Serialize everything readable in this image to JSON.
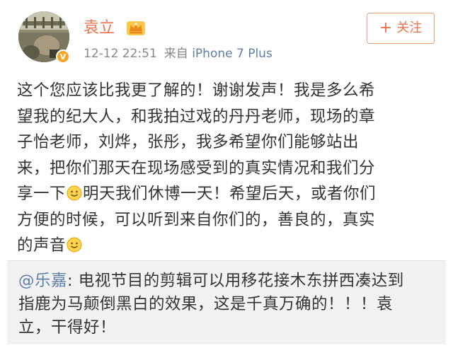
{
  "user": {
    "name": "袁立",
    "verified_badge": "V",
    "time": "12-12 22:51",
    "source_prefix": "来自",
    "device": "iPhone 7 Plus"
  },
  "follow": {
    "plus": "+",
    "label": "关注"
  },
  "post": {
    "lines": [
      "这个您应该比我更了解的！谢谢发声！我是多么希",
      "望我的纪大人，和我拍过戏的丹丹老师，现场的章",
      "子怡老师，刘烨，张彤，我多希望你们能够站出",
      "来，把你们那天在现场感受到的真实情况和我们分",
      "享一下",
      "明天我们休博一天！希望后天，或者你们",
      "方便的时候，可以听到来自你们的，善良的，真实",
      "的声音"
    ],
    "emoji_names": [
      "smile-emoji",
      "smile-emoji"
    ]
  },
  "retweet": {
    "mention": "@乐嘉",
    "colon": ": ",
    "line1": "电视节目的剪辑可以用移花接木东拼西凑达到",
    "line2": "指鹿为马颠倒黑白的效果，这是千真万确的！！！袁",
    "line3": "立，干得好！"
  },
  "colors": {
    "name": "#eb7350",
    "link": "#5d7fa8",
    "meta": "#888888",
    "badge": "#f5a623",
    "retweet_bg": "#f2f2f2"
  }
}
